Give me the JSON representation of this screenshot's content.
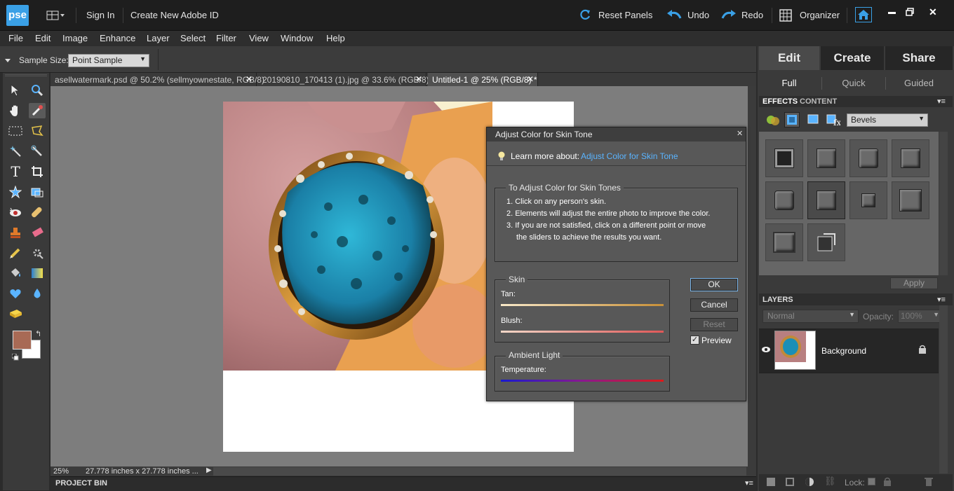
{
  "app": {
    "logo": "pse"
  },
  "titlebar": {
    "sign_in": "Sign In",
    "create_id": "Create New Adobe ID",
    "reset_panels": "Reset Panels",
    "undo": "Undo",
    "redo": "Redo",
    "organizer": "Organizer"
  },
  "menu": [
    "File",
    "Edit",
    "Image",
    "Enhance",
    "Layer",
    "Select",
    "Filter",
    "View",
    "Window",
    "Help"
  ],
  "options": {
    "sample_size_label": "Sample Size:",
    "sample_size_value": "Point Sample"
  },
  "tabs": [
    {
      "label": "asellwatermark.psd @ 50.2% (sellmyownestate, RGB/8)"
    },
    {
      "label": "20190810_170413 (1).jpg @ 33.6% (RGB/8) *"
    },
    {
      "label": "Untitled-1 @ 25% (RGB/8) *"
    }
  ],
  "status": {
    "zoom": "25%",
    "doc_size": "27.778 inches x 27.778 inches ..."
  },
  "project_bin": {
    "label": "PROJECT BIN"
  },
  "right": {
    "main_tabs": [
      "Edit",
      "Create",
      "Share"
    ],
    "sub_tabs": [
      "Full",
      "Quick",
      "Guided"
    ],
    "effects_tab": "EFFECTS",
    "content_tab": "CONTENT",
    "effects_select": "Bevels",
    "apply": "Apply",
    "layers_title": "LAYERS",
    "blend_mode": "Normal",
    "opacity_label": "Opacity:",
    "opacity_value": "100%",
    "layer_name": "Background",
    "lock_label": "Lock:"
  },
  "dialog": {
    "title": "Adjust Color for Skin Tone",
    "learn_prefix": "Learn more about:",
    "learn_link": "Adjust Color for Skin Tone",
    "instructions_title": "To Adjust Color for Skin Tones",
    "steps": [
      "1. Click on any person's skin.",
      "2. Elements will adjust the entire photo to improve the color.",
      "3. If you are not satisfied, click on a different point or move",
      "the sliders to achieve the results you want."
    ],
    "skin_title": "Skin",
    "tan_label": "Tan:",
    "blush_label": "Blush:",
    "ambient_title": "Ambient Light",
    "temperature_label": "Temperature:",
    "ok": "OK",
    "cancel": "Cancel",
    "reset": "Reset",
    "preview": "Preview"
  },
  "colors": {
    "accent": "#3aa0e6",
    "foreground_swatch": "#a86a55",
    "background_swatch": "#ffffff"
  }
}
